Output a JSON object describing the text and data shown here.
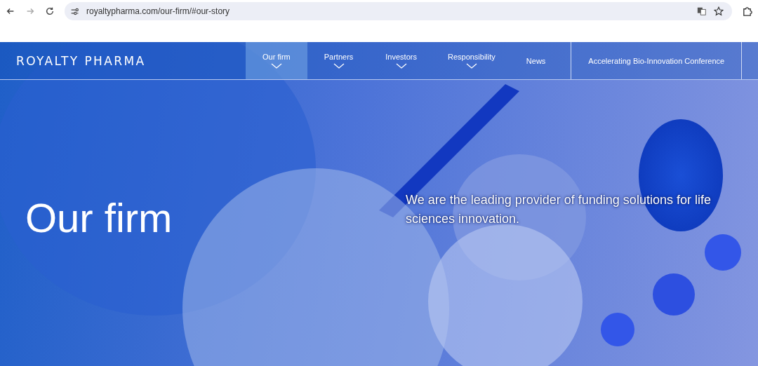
{
  "browser": {
    "url": "royaltypharma.com/our-firm/#our-story"
  },
  "site_header": {
    "logo": "ROYALTY PHARMA",
    "nav": [
      {
        "label": "Our firm",
        "selected": true,
        "has_dropdown": true
      },
      {
        "label": "Partners",
        "selected": false,
        "has_dropdown": true
      },
      {
        "label": "Investors",
        "selected": false,
        "has_dropdown": true
      },
      {
        "label": "Responsibility",
        "selected": false,
        "has_dropdown": true
      },
      {
        "label": "News",
        "selected": false,
        "has_dropdown": false
      }
    ],
    "cta": "Accelerating Bio-Innovation Conference"
  },
  "hero": {
    "title": "Our firm",
    "tagline": "We are the leading provider of funding solutions for life sciences innovation."
  }
}
